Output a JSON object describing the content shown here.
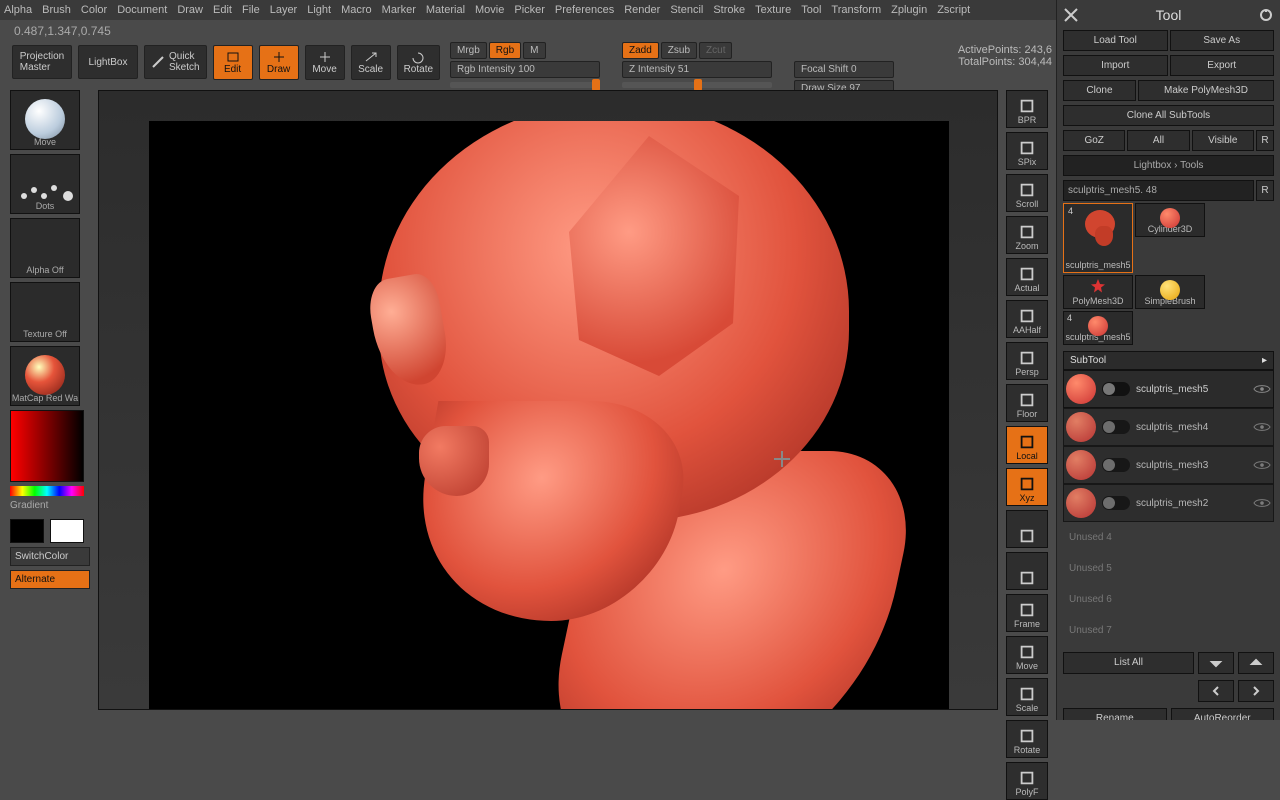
{
  "menubar": [
    "Alpha",
    "Brush",
    "Color",
    "Document",
    "Draw",
    "Edit",
    "File",
    "Layer",
    "Light",
    "Macro",
    "Marker",
    "Material",
    "Movie",
    "Picker",
    "Preferences",
    "Render",
    "Stencil",
    "Stroke",
    "Texture",
    "Tool",
    "Transform",
    "Zplugin",
    "Zscript"
  ],
  "coords": "0.487,1.347,0.745",
  "toolbar": {
    "projection_master": "Projection\nMaster",
    "lightbox": "LightBox",
    "quick_sketch": "Quick\nSketch",
    "edit": "Edit",
    "draw": "Draw",
    "move": "Move",
    "scale": "Scale",
    "rotate": "Rotate"
  },
  "mode": {
    "mrgb": "Mrgb",
    "rgb": "Rgb",
    "m": "M",
    "zadd": "Zadd",
    "zsub": "Zsub",
    "zcut": "Zcut",
    "rgb_label": "Rgb Intensity 100",
    "z_label": "Z Intensity 51",
    "focal": "Focal Shift 0",
    "draw_size": "Draw Size 97"
  },
  "stats": {
    "active": "ActivePoints: 243,6",
    "total": "TotalPoints: 304,44"
  },
  "left": {
    "brush_label": "Move",
    "stroke_label": "Dots",
    "alpha_label": "Alpha Off",
    "texture_label": "Texture Off",
    "material_label": "MatCap Red Wa",
    "gradient": "Gradient",
    "switch": "SwitchColor",
    "alternate": "Alternate"
  },
  "rtools": [
    "BPR",
    "SPix",
    "Scroll",
    "Zoom",
    "Actual",
    "AAHalf",
    "Persp",
    "Floor",
    "Local",
    "Xyz",
    "",
    "",
    "Frame",
    "Move",
    "Scale",
    "Rotate",
    "PolyF"
  ],
  "tool_panel": {
    "title": "Tool",
    "load": "Load Tool",
    "save": "Save As",
    "import": "Import",
    "export": "Export",
    "clone": "Clone",
    "make_poly": "Make PolyMesh3D",
    "clone_all": "Clone All SubTools",
    "goz": "GoZ",
    "all": "All",
    "visible": "Visible",
    "r": "R",
    "lightbox_tools": "Lightbox › Tools",
    "current": "sculptris_mesh5. 48",
    "r2": "R",
    "tools": [
      {
        "name": "sculptris_mesh5",
        "badge": "4"
      },
      {
        "name": "Cylinder3D"
      },
      {
        "name": "SimpleBrush"
      },
      {
        "name": "PolyMesh3D"
      },
      {
        "name": "sculptris_mesh5",
        "badge": "4"
      }
    ],
    "subtool_title": "SubTool",
    "subtools": [
      {
        "name": "sculptris_mesh5",
        "active": true
      },
      {
        "name": "sculptris_mesh4"
      },
      {
        "name": "sculptris_mesh3"
      },
      {
        "name": "sculptris_mesh2"
      }
    ],
    "unused": [
      "Unused 4",
      "Unused 5",
      "Unused 6",
      "Unused 7"
    ],
    "list_all": "List All",
    "rename": "Rename",
    "reorder": "AutoReorder"
  }
}
